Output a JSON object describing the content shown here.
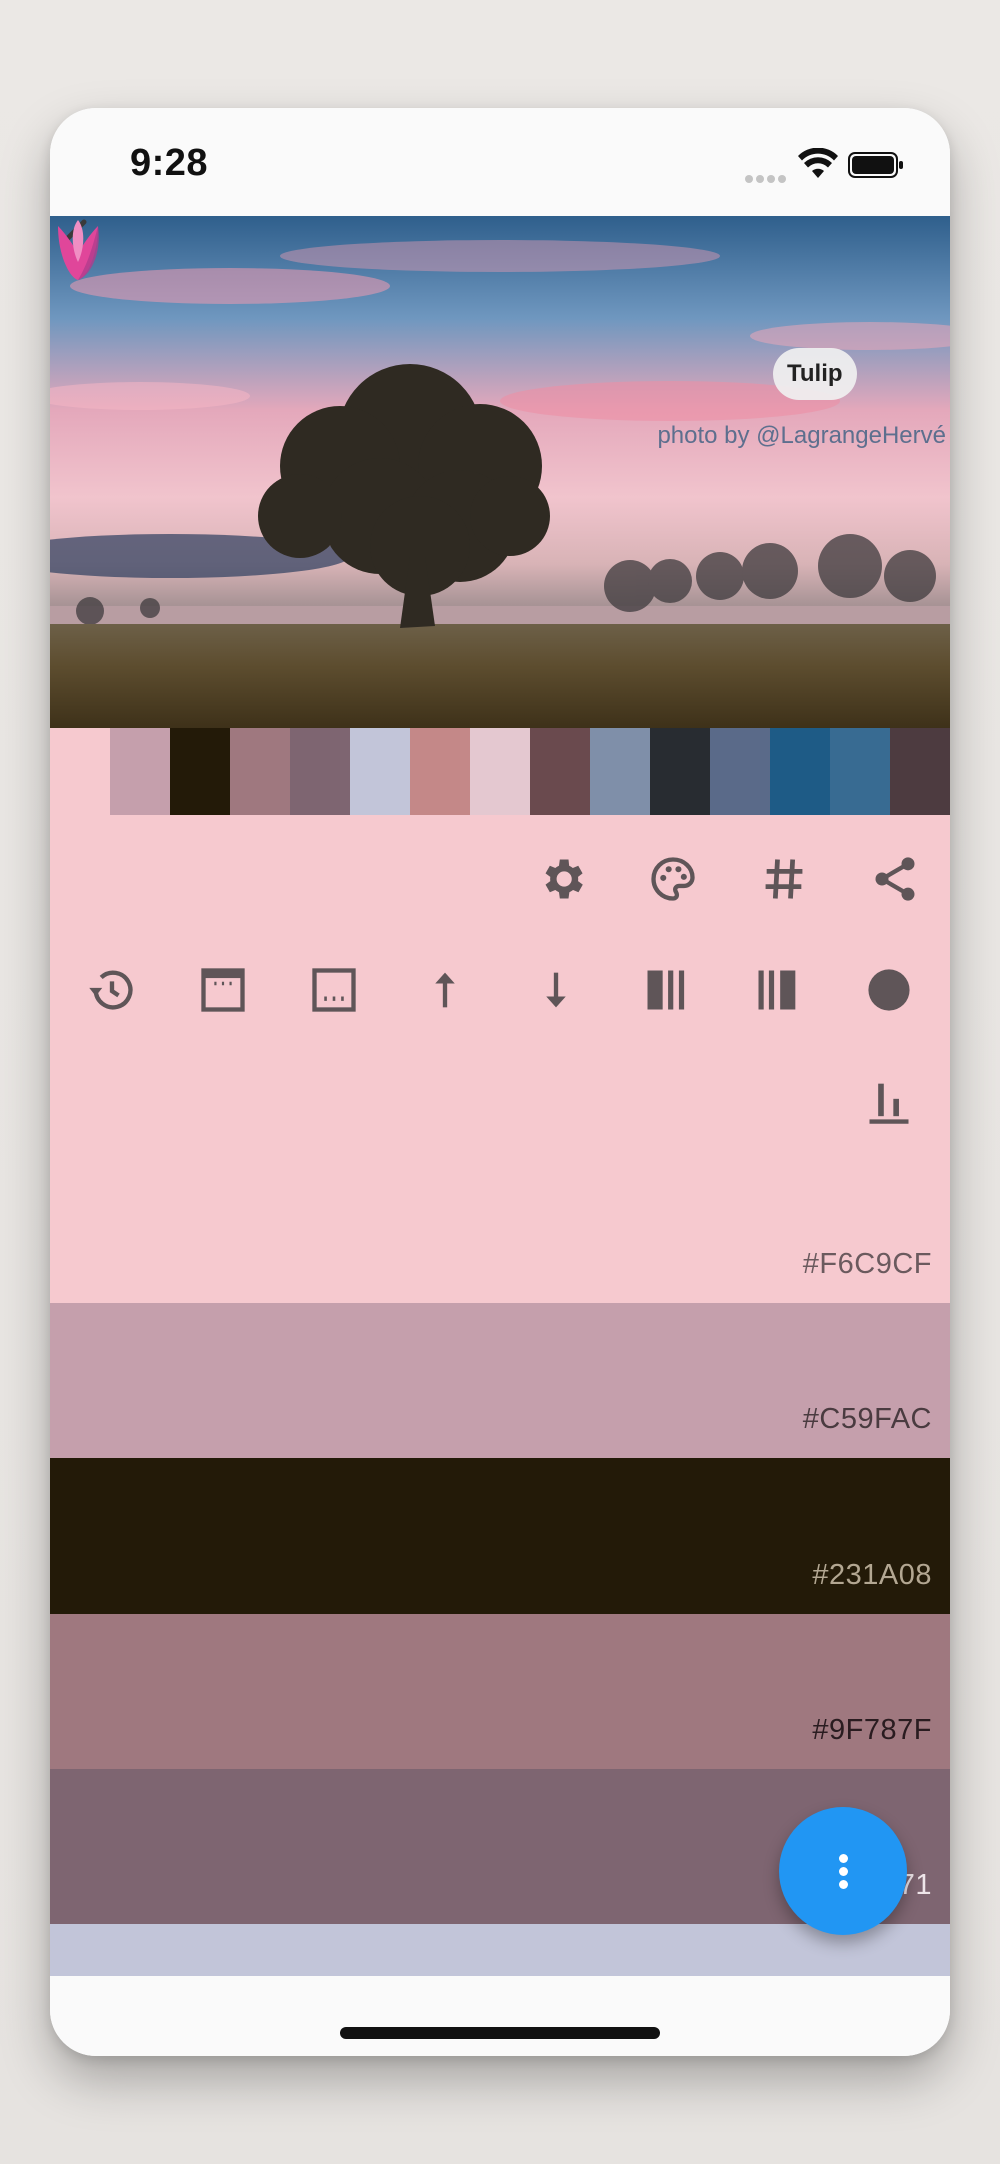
{
  "status_bar": {
    "time": "9:28"
  },
  "hero": {
    "chip_label": "Tulip",
    "credit": "photo by @LagrangeHervé"
  },
  "strip_colors": [
    "#F6C9CF",
    "#C59FAC",
    "#231A08",
    "#9F787F",
    "#7E6571",
    "#C2C5D9",
    "#C48888",
    "#E4C8D0",
    "#6A4A4E",
    "#7F8FA9",
    "#282C31",
    "#5A6A89",
    "#1E5B86",
    "#386B92",
    "#4D3B40"
  ],
  "toolbar": {
    "row1": [
      "gear-icon",
      "palette-icon",
      "hash-icon",
      "share-icon"
    ],
    "row2": [
      "history-icon",
      "top-border-icon",
      "bottom-border-icon",
      "arrow-up-icon",
      "arrow-down-icon",
      "columns-left-icon",
      "columns-right-icon",
      "circle-icon"
    ],
    "row3": [
      "align-bottom-icon"
    ],
    "icon_color": "#5f5558"
  },
  "swatches": [
    {
      "hex": "#F6C9CF",
      "color": "#F6C9CF",
      "text_color": "#6b5a5e"
    },
    {
      "hex": "#C59FAC",
      "color": "#C59FAC",
      "text_color": "#4a3b40"
    },
    {
      "hex": "#231A08",
      "color": "#231A08",
      "text_color": "#b3a792"
    },
    {
      "hex": "#9F787F",
      "color": "#9F787F",
      "text_color": "#2a1c20"
    },
    {
      "hex": "#7E6571",
      "color": "#7E6571",
      "text_color": "#efe6ea"
    }
  ],
  "partial_swatch_color": "#C2C5D9"
}
